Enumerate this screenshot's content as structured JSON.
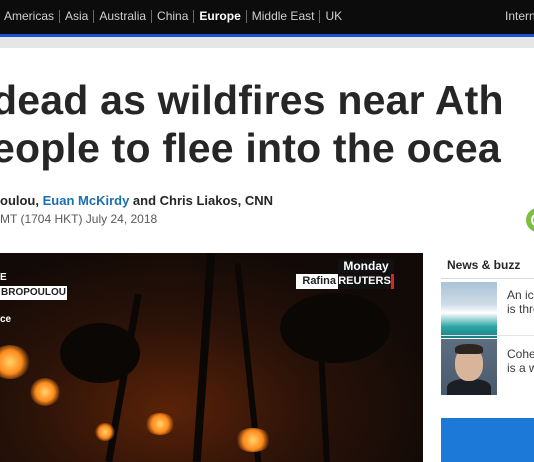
{
  "topnav": {
    "regions": [
      "Americas",
      "Asia",
      "Australia",
      "China",
      "Europe",
      "Middle East",
      "UK"
    ],
    "active_region": "Europe",
    "edition_label": "Intern"
  },
  "colors": {
    "nav_background": "#0c0c0c",
    "accent_bar": "#1f4fd6",
    "link_blue": "#1a6fb0",
    "reuters_red": "#e2211c",
    "share_green": "#7dbf3c"
  },
  "article": {
    "headline_line1": "dead as wildfires near Ath",
    "headline_line2": "eople to flee into the ocea",
    "byline_start": "oulou, ",
    "byline_link": "Euan McKirdy",
    "byline_end": " and Chris Liakos, CNN",
    "timestamp": "MT (1704 HKT) July 24, 2018",
    "share_icon": "share-icon"
  },
  "video": {
    "chyron_label": "E",
    "chyron_name": "BROPOULOU",
    "chyron_sub": "ce",
    "day": "Monday",
    "location": "Rafina",
    "source": "REUTERS"
  },
  "sidebar": {
    "title": "News & buzz",
    "items": [
      {
        "line1": "An ice",
        "line2": "is thre"
      },
      {
        "line1": "Cohe",
        "line2": "is a w"
      }
    ]
  }
}
